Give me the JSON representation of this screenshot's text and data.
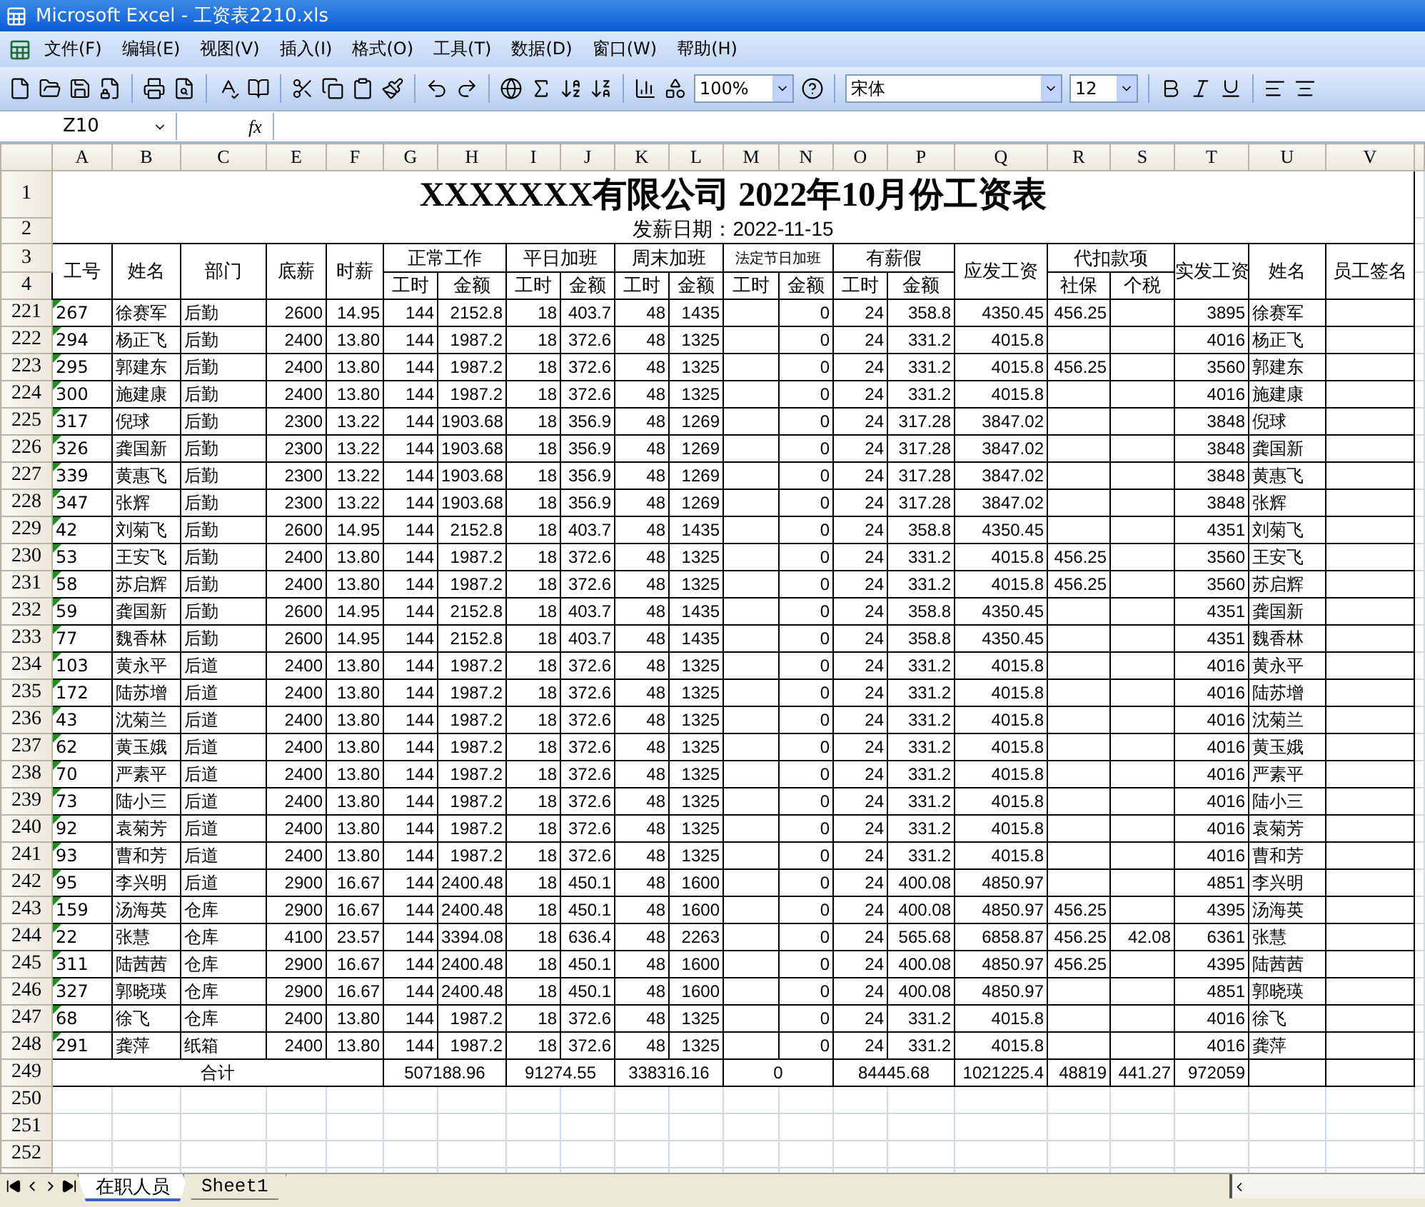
{
  "window": {
    "title": "Microsoft Excel - 工资表2210.xls"
  },
  "menu": [
    "文件(F)",
    "编辑(E)",
    "视图(V)",
    "插入(I)",
    "格式(O)",
    "工具(T)",
    "数据(D)",
    "窗口(W)",
    "帮助(H)"
  ],
  "toolbar": {
    "zoom": "100%",
    "font": "宋体",
    "size": "12"
  },
  "formula_bar": {
    "name_box": "Z10",
    "function_label": "fx"
  },
  "columns": [
    "A",
    "B",
    "C",
    "E",
    "F",
    "G",
    "H",
    "I",
    "J",
    "K",
    "L",
    "M",
    "N",
    "O",
    "P",
    "Q",
    "R",
    "S",
    "T",
    "U",
    "V"
  ],
  "title": {
    "row": "1",
    "text": "XXXXXXX有限公司 2022年10月份工资表"
  },
  "date": {
    "row": "2",
    "text": "发薪日期：2022-11-15"
  },
  "header": {
    "rows": [
      "3",
      "4"
    ],
    "groups": [
      {
        "label": "工号"
      },
      {
        "label": "姓名"
      },
      {
        "label": "部门"
      },
      {
        "label": "底薪"
      },
      {
        "label": "时薪"
      },
      {
        "label": "正常工作",
        "sub": [
          "工时",
          "金额"
        ]
      },
      {
        "label": "平日加班",
        "sub": [
          "工时",
          "金额"
        ]
      },
      {
        "label": "周末加班",
        "sub": [
          "工时",
          "金额"
        ]
      },
      {
        "label": "法定节日加班",
        "sub": [
          "工时",
          "金额"
        ]
      },
      {
        "label": "有薪假",
        "sub": [
          "工时",
          "金额"
        ]
      },
      {
        "label": "应发工资"
      },
      {
        "label": "代扣款项",
        "sub": [
          "社保",
          "个税"
        ]
      },
      {
        "label": "实发工资"
      },
      {
        "label": "姓名"
      },
      {
        "label": "员工签名"
      }
    ]
  },
  "rows": [
    {
      "row": "221",
      "flag": true,
      "cells": [
        "267",
        "徐赛军",
        "后勤",
        "2600",
        "14.95",
        "144",
        "2152.8",
        "18",
        "403.7",
        "48",
        "1435",
        null,
        "0",
        "24",
        "358.8",
        "4350.45",
        "456.25",
        null,
        "3895",
        "徐赛军",
        null
      ]
    },
    {
      "row": "222",
      "flag": true,
      "cells": [
        "294",
        "杨正飞",
        "后勤",
        "2400",
        "13.80",
        "144",
        "1987.2",
        "18",
        "372.6",
        "48",
        "1325",
        null,
        "0",
        "24",
        "331.2",
        "4015.8",
        null,
        null,
        "4016",
        "杨正飞",
        null
      ]
    },
    {
      "row": "223",
      "flag": true,
      "cells": [
        "295",
        "郭建东",
        "后勤",
        "2400",
        "13.80",
        "144",
        "1987.2",
        "18",
        "372.6",
        "48",
        "1325",
        null,
        "0",
        "24",
        "331.2",
        "4015.8",
        "456.25",
        null,
        "3560",
        "郭建东",
        null
      ]
    },
    {
      "row": "224",
      "flag": true,
      "cells": [
        "300",
        "施建康",
        "后勤",
        "2400",
        "13.80",
        "144",
        "1987.2",
        "18",
        "372.6",
        "48",
        "1325",
        null,
        "0",
        "24",
        "331.2",
        "4015.8",
        null,
        null,
        "4016",
        "施建康",
        null
      ]
    },
    {
      "row": "225",
      "flag": true,
      "cells": [
        "317",
        "倪球",
        "后勤",
        "2300",
        "13.22",
        "144",
        "1903.68",
        "18",
        "356.9",
        "48",
        "1269",
        null,
        "0",
        "24",
        "317.28",
        "3847.02",
        null,
        null,
        "3848",
        "倪球",
        null
      ]
    },
    {
      "row": "226",
      "flag": true,
      "cells": [
        "326",
        "龚国新",
        "后勤",
        "2300",
        "13.22",
        "144",
        "1903.68",
        "18",
        "356.9",
        "48",
        "1269",
        null,
        "0",
        "24",
        "317.28",
        "3847.02",
        null,
        null,
        "3848",
        "龚国新",
        null
      ]
    },
    {
      "row": "227",
      "flag": true,
      "cells": [
        "339",
        "黄惠飞",
        "后勤",
        "2300",
        "13.22",
        "144",
        "1903.68",
        "18",
        "356.9",
        "48",
        "1269",
        null,
        "0",
        "24",
        "317.28",
        "3847.02",
        null,
        null,
        "3848",
        "黄惠飞",
        null
      ]
    },
    {
      "row": "228",
      "flag": true,
      "cells": [
        "347",
        "张辉",
        "后勤",
        "2300",
        "13.22",
        "144",
        "1903.68",
        "18",
        "356.9",
        "48",
        "1269",
        null,
        "0",
        "24",
        "317.28",
        "3847.02",
        null,
        null,
        "3848",
        "张辉",
        null
      ]
    },
    {
      "row": "229",
      "flag": true,
      "cells": [
        "42",
        "刘菊飞",
        "后勤",
        "2600",
        "14.95",
        "144",
        "2152.8",
        "18",
        "403.7",
        "48",
        "1435",
        null,
        "0",
        "24",
        "358.8",
        "4350.45",
        null,
        null,
        "4351",
        "刘菊飞",
        null
      ]
    },
    {
      "row": "230",
      "flag": true,
      "cells": [
        "53",
        "王安飞",
        "后勤",
        "2400",
        "13.80",
        "144",
        "1987.2",
        "18",
        "372.6",
        "48",
        "1325",
        null,
        "0",
        "24",
        "331.2",
        "4015.8",
        "456.25",
        null,
        "3560",
        "王安飞",
        null
      ]
    },
    {
      "row": "231",
      "flag": true,
      "cells": [
        "58",
        "苏启辉",
        "后勤",
        "2400",
        "13.80",
        "144",
        "1987.2",
        "18",
        "372.6",
        "48",
        "1325",
        null,
        "0",
        "24",
        "331.2",
        "4015.8",
        "456.25",
        null,
        "3560",
        "苏启辉",
        null
      ]
    },
    {
      "row": "232",
      "flag": true,
      "cells": [
        "59",
        "龚国新",
        "后勤",
        "2600",
        "14.95",
        "144",
        "2152.8",
        "18",
        "403.7",
        "48",
        "1435",
        null,
        "0",
        "24",
        "358.8",
        "4350.45",
        null,
        null,
        "4351",
        "龚国新",
        null
      ]
    },
    {
      "row": "233",
      "flag": true,
      "cells": [
        "77",
        "魏香林",
        "后勤",
        "2600",
        "14.95",
        "144",
        "2152.8",
        "18",
        "403.7",
        "48",
        "1435",
        null,
        "0",
        "24",
        "358.8",
        "4350.45",
        null,
        null,
        "4351",
        "魏香林",
        null
      ]
    },
    {
      "row": "234",
      "flag": true,
      "cells": [
        "103",
        "黄永平",
        "后道",
        "2400",
        "13.80",
        "144",
        "1987.2",
        "18",
        "372.6",
        "48",
        "1325",
        null,
        "0",
        "24",
        "331.2",
        "4015.8",
        null,
        null,
        "4016",
        "黄永平",
        null
      ]
    },
    {
      "row": "235",
      "flag": true,
      "cells": [
        "172",
        "陆苏增",
        "后道",
        "2400",
        "13.80",
        "144",
        "1987.2",
        "18",
        "372.6",
        "48",
        "1325",
        null,
        "0",
        "24",
        "331.2",
        "4015.8",
        null,
        null,
        "4016",
        "陆苏增",
        null
      ]
    },
    {
      "row": "236",
      "flag": true,
      "cells": [
        "43",
        "沈菊兰",
        "后道",
        "2400",
        "13.80",
        "144",
        "1987.2",
        "18",
        "372.6",
        "48",
        "1325",
        null,
        "0",
        "24",
        "331.2",
        "4015.8",
        null,
        null,
        "4016",
        "沈菊兰",
        null
      ]
    },
    {
      "row": "237",
      "flag": true,
      "cells": [
        "62",
        "黄玉娥",
        "后道",
        "2400",
        "13.80",
        "144",
        "1987.2",
        "18",
        "372.6",
        "48",
        "1325",
        null,
        "0",
        "24",
        "331.2",
        "4015.8",
        null,
        null,
        "4016",
        "黄玉娥",
        null
      ]
    },
    {
      "row": "238",
      "flag": true,
      "cells": [
        "70",
        "严素平",
        "后道",
        "2400",
        "13.80",
        "144",
        "1987.2",
        "18",
        "372.6",
        "48",
        "1325",
        null,
        "0",
        "24",
        "331.2",
        "4015.8",
        null,
        null,
        "4016",
        "严素平",
        null
      ]
    },
    {
      "row": "239",
      "flag": true,
      "cells": [
        "73",
        "陆小三",
        "后道",
        "2400",
        "13.80",
        "144",
        "1987.2",
        "18",
        "372.6",
        "48",
        "1325",
        null,
        "0",
        "24",
        "331.2",
        "4015.8",
        null,
        null,
        "4016",
        "陆小三",
        null
      ]
    },
    {
      "row": "240",
      "flag": true,
      "cells": [
        "92",
        "袁菊芳",
        "后道",
        "2400",
        "13.80",
        "144",
        "1987.2",
        "18",
        "372.6",
        "48",
        "1325",
        null,
        "0",
        "24",
        "331.2",
        "4015.8",
        null,
        null,
        "4016",
        "袁菊芳",
        null
      ]
    },
    {
      "row": "241",
      "flag": true,
      "cells": [
        "93",
        "曹和芳",
        "后道",
        "2400",
        "13.80",
        "144",
        "1987.2",
        "18",
        "372.6",
        "48",
        "1325",
        null,
        "0",
        "24",
        "331.2",
        "4015.8",
        null,
        null,
        "4016",
        "曹和芳",
        null
      ]
    },
    {
      "row": "242",
      "flag": true,
      "cells": [
        "95",
        "李兴明",
        "后道",
        "2900",
        "16.67",
        "144",
        "2400.48",
        "18",
        "450.1",
        "48",
        "1600",
        null,
        "0",
        "24",
        "400.08",
        "4850.97",
        null,
        null,
        "4851",
        "李兴明",
        null
      ]
    },
    {
      "row": "243",
      "flag": true,
      "cells": [
        "159",
        "汤海英",
        "仓库",
        "2900",
        "16.67",
        "144",
        "2400.48",
        "18",
        "450.1",
        "48",
        "1600",
        null,
        "0",
        "24",
        "400.08",
        "4850.97",
        "456.25",
        null,
        "4395",
        "汤海英",
        null
      ]
    },
    {
      "row": "244",
      "flag": true,
      "cells": [
        "22",
        "张慧",
        "仓库",
        "4100",
        "23.57",
        "144",
        "3394.08",
        "18",
        "636.4",
        "48",
        "2263",
        null,
        "0",
        "24",
        "565.68",
        "6858.87",
        "456.25",
        "42.08",
        "6361",
        "张慧",
        null
      ]
    },
    {
      "row": "245",
      "flag": true,
      "cells": [
        "311",
        "陆茜茜",
        "仓库",
        "2900",
        "16.67",
        "144",
        "2400.48",
        "18",
        "450.1",
        "48",
        "1600",
        null,
        "0",
        "24",
        "400.08",
        "4850.97",
        "456.25",
        null,
        "4395",
        "陆茜茜",
        null
      ]
    },
    {
      "row": "246",
      "flag": true,
      "cells": [
        "327",
        "郭晓瑛",
        "仓库",
        "2900",
        "16.67",
        "144",
        "2400.48",
        "18",
        "450.1",
        "48",
        "1600",
        null,
        "0",
        "24",
        "400.08",
        "4850.97",
        null,
        null,
        "4851",
        "郭晓瑛",
        null
      ]
    },
    {
      "row": "247",
      "flag": true,
      "cells": [
        "68",
        "徐飞",
        "仓库",
        "2400",
        "13.80",
        "144",
        "1987.2",
        "18",
        "372.6",
        "48",
        "1325",
        null,
        "0",
        "24",
        "331.2",
        "4015.8",
        null,
        null,
        "4016",
        "徐飞",
        null
      ]
    },
    {
      "row": "248",
      "flag": true,
      "cells": [
        "291",
        "龚萍",
        "纸箱",
        "2400",
        "13.80",
        "144",
        "1987.2",
        "18",
        "372.6",
        "48",
        "1325",
        null,
        "0",
        "24",
        "331.2",
        "4015.8",
        null,
        null,
        "4016",
        "龚萍",
        null
      ]
    }
  ],
  "total": {
    "row": "249",
    "label": "合计",
    "values": [
      "507188.96",
      "91274.55",
      "338316.16",
      "0",
      "84445.68",
      "1021225.4",
      "48819",
      "441.27",
      "972059"
    ]
  },
  "empty_rows": [
    "250",
    "251",
    "252"
  ],
  "sheet_tabs": [
    {
      "label": "在职人员",
      "selected": true
    },
    {
      "label": "Sheet1",
      "selected": false
    }
  ]
}
